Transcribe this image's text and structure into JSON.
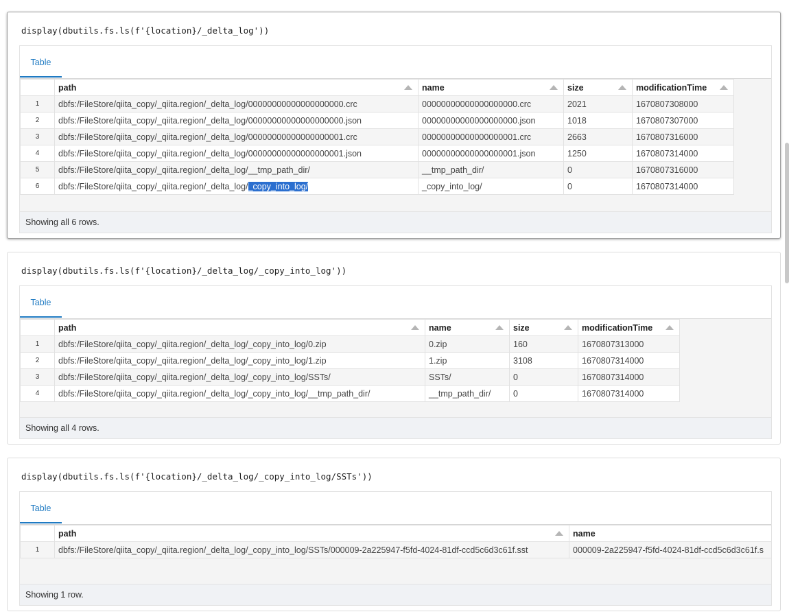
{
  "cells": [
    {
      "code": "display(dbutils.fs.ls(f'{location}/_delta_log'))",
      "tab": "Table",
      "columns": [
        "path",
        "name",
        "size",
        "modificationTime"
      ],
      "rows": [
        [
          "1",
          "dbfs:/FileStore/qiita_copy/_qiita.region/_delta_log/00000000000000000000.crc",
          "00000000000000000000.crc",
          "2021",
          "1670807308000"
        ],
        [
          "2",
          "dbfs:/FileStore/qiita_copy/_qiita.region/_delta_log/00000000000000000000.json",
          "00000000000000000000.json",
          "1018",
          "1670807307000"
        ],
        [
          "3",
          "dbfs:/FileStore/qiita_copy/_qiita.region/_delta_log/00000000000000000001.crc",
          "00000000000000000001.crc",
          "2663",
          "1670807316000"
        ],
        [
          "4",
          "dbfs:/FileStore/qiita_copy/_qiita.region/_delta_log/00000000000000000001.json",
          "00000000000000000001.json",
          "1250",
          "1670807314000"
        ],
        [
          "5",
          "dbfs:/FileStore/qiita_copy/_qiita.region/_delta_log/__tmp_path_dir/",
          "__tmp_path_dir/",
          "0",
          "1670807316000"
        ],
        [
          "6",
          "dbfs:/FileStore/qiita_copy/_qiita.region/_delta_log/_copy_into_log/",
          "_copy_into_log/",
          "0",
          "1670807314000"
        ]
      ],
      "selected_prefix": "dbfs:/FileStore/qiita_copy/_qiita.region/_delta_log/",
      "selected_text": "_copy_into_log/",
      "footer": "Showing all 6 rows."
    },
    {
      "code": "display(dbutils.fs.ls(f'{location}/_delta_log/_copy_into_log'))",
      "tab": "Table",
      "columns": [
        "path",
        "name",
        "size",
        "modificationTime"
      ],
      "rows": [
        [
          "1",
          "dbfs:/FileStore/qiita_copy/_qiita.region/_delta_log/_copy_into_log/0.zip",
          "0.zip",
          "160",
          "1670807313000"
        ],
        [
          "2",
          "dbfs:/FileStore/qiita_copy/_qiita.region/_delta_log/_copy_into_log/1.zip",
          "1.zip",
          "3108",
          "1670807314000"
        ],
        [
          "3",
          "dbfs:/FileStore/qiita_copy/_qiita.region/_delta_log/_copy_into_log/SSTs/",
          "SSTs/",
          "0",
          "1670807314000"
        ],
        [
          "4",
          "dbfs:/FileStore/qiita_copy/_qiita.region/_delta_log/_copy_into_log/__tmp_path_dir/",
          "__tmp_path_dir/",
          "0",
          "1670807314000"
        ]
      ],
      "footer": "Showing all 4 rows."
    },
    {
      "code": "display(dbutils.fs.ls(f'{location}/_delta_log/_copy_into_log/SSTs'))",
      "tab": "Table",
      "columns": [
        "path",
        "name"
      ],
      "rows": [
        [
          "1",
          "dbfs:/FileStore/qiita_copy/_qiita.region/_delta_log/_copy_into_log/SSTs/000009-2a225947-f5fd-4024-81df-ccd5c6d3c61f.sst",
          "000009-2a225947-f5fd-4024-81df-ccd5c6d3c61f.s"
        ]
      ],
      "footer": "Showing 1 row."
    }
  ],
  "colors": {
    "accent": "#1f7ac2",
    "selection": "#2b6fcf"
  }
}
